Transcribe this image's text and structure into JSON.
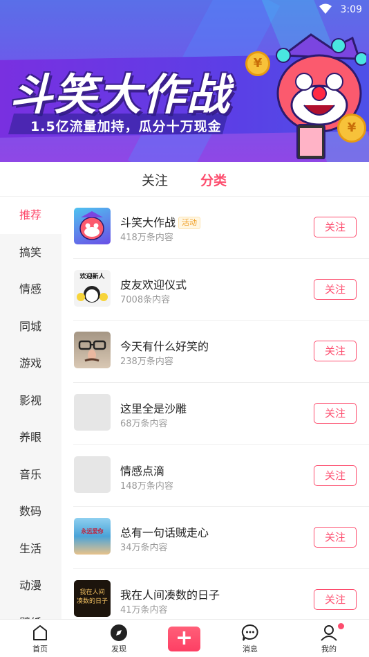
{
  "status_bar": {
    "time": "3:09"
  },
  "banner": {
    "title": "斗笑大作战",
    "subtitle": "1.5亿流量加持，瓜分十万现金",
    "coin_symbol": "¥"
  },
  "tabs": [
    {
      "label": "关注",
      "active": false
    },
    {
      "label": "分类",
      "active": true
    }
  ],
  "sidebar": {
    "items": [
      {
        "label": "推荐",
        "active": true
      },
      {
        "label": "搞笑"
      },
      {
        "label": "情感"
      },
      {
        "label": "同城"
      },
      {
        "label": "游戏"
      },
      {
        "label": "影视"
      },
      {
        "label": "养眼"
      },
      {
        "label": "音乐"
      },
      {
        "label": "数码"
      },
      {
        "label": "生活"
      },
      {
        "label": "动漫"
      },
      {
        "label": "壁纸"
      }
    ]
  },
  "list": {
    "follow_label": "关注",
    "items": [
      {
        "title": "斗笑大作战",
        "badge": "活动",
        "count": "418万条内容",
        "thumb": "clown-avatar"
      },
      {
        "title": "皮友欢迎仪式",
        "count": "7008条内容",
        "thumb": "welcome-cartoon",
        "thumb_text": "欢迎新人"
      },
      {
        "title": "今天有什么好笑的",
        "count": "238万条内容",
        "thumb": "glasses-face"
      },
      {
        "title": "这里全是沙雕",
        "count": "68万条内容",
        "thumb": "placeholder"
      },
      {
        "title": "情感点滴",
        "count": "148万条内容",
        "thumb": "placeholder"
      },
      {
        "title": "总有一句话贼走心",
        "count": "34万条内容",
        "thumb": "beach-photo",
        "thumb_text": "永远爱你"
      },
      {
        "title": "我在人间凑数的日子",
        "count": "41万条内容",
        "thumb": "dark-text",
        "thumb_text": "我在人间 凑数的日子"
      }
    ]
  },
  "bottom_nav": {
    "home": "首页",
    "discover": "发现",
    "add": "+",
    "messages": "消息",
    "mine": "我的"
  },
  "colors": {
    "accent": "#fd4d6e",
    "badge_text": "#f0a028"
  }
}
